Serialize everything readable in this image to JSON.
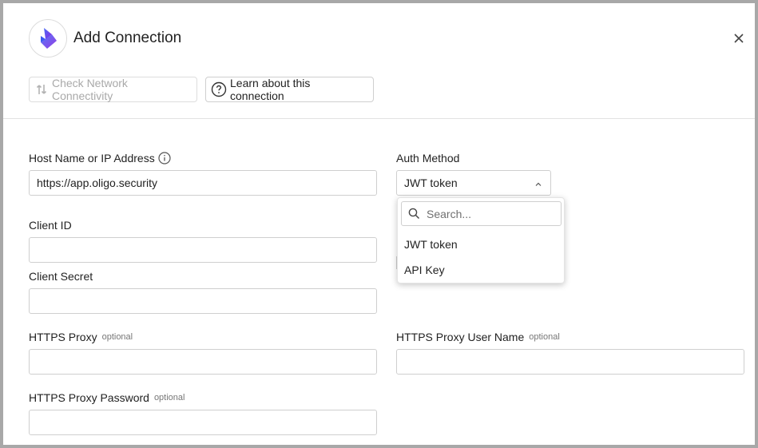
{
  "dialog": {
    "title": "Add Connection",
    "brand_color": "#6a3de8"
  },
  "toolbar": {
    "check_network_label": "Check Network Connectivity",
    "learn_label": "Learn about this connection"
  },
  "fields": {
    "host": {
      "label": "Host Name or IP Address",
      "value": "https://app.oligo.security"
    },
    "client_id": {
      "label": "Client ID",
      "value": ""
    },
    "client_secret": {
      "label": "Client Secret",
      "value": ""
    },
    "https_proxy": {
      "label": "HTTPS Proxy",
      "optional": "optional",
      "value": ""
    },
    "https_proxy_user": {
      "label": "HTTPS Proxy User Name",
      "optional": "optional",
      "value": ""
    },
    "https_proxy_password": {
      "label": "HTTPS Proxy Password",
      "optional": "optional",
      "value": ""
    }
  },
  "auth": {
    "label": "Auth Method",
    "selected": "JWT token",
    "search_placeholder": "Search...",
    "options": [
      "JWT token",
      "API Key"
    ]
  }
}
